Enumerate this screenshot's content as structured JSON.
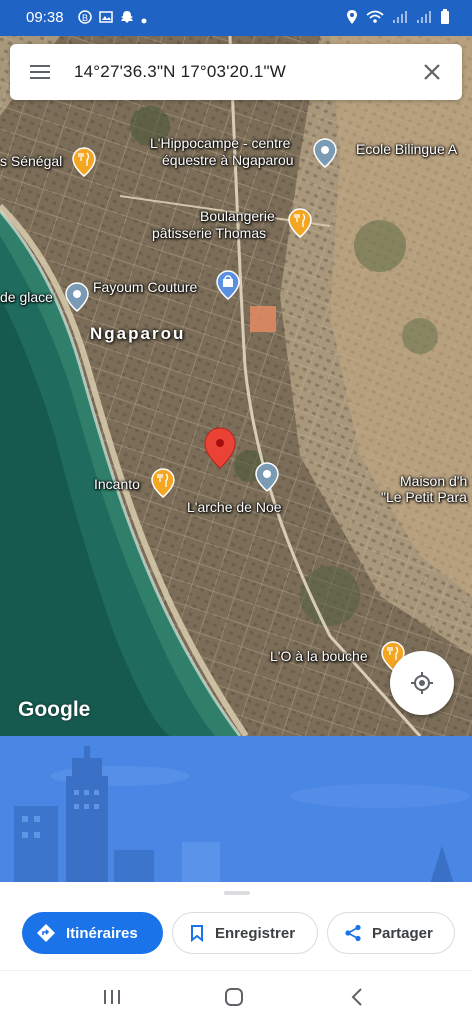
{
  "status_bar": {
    "time": "09:38"
  },
  "search": {
    "coordinates": "14°27'36.3\"N 17°03'20.1\"W"
  },
  "map": {
    "area_name": "Ngaparou",
    "places": [
      {
        "name": "s Sénégal",
        "type": "restaurant"
      },
      {
        "name": "L'Hippocampe - centre",
        "name2": "équestre à Ngaparou",
        "type": "place"
      },
      {
        "name": "Ecole Bilingue A",
        "type": "place"
      },
      {
        "name": "Boulangerie",
        "name2": "pâtisserie Thomas",
        "type": "restaurant"
      },
      {
        "name": "de glace",
        "type": "place"
      },
      {
        "name": "Fayoum Couture",
        "type": "shop"
      },
      {
        "name": "Incanto",
        "type": "restaurant"
      },
      {
        "name": "L'arche de Noe",
        "type": "place"
      },
      {
        "name": "Maison d'h",
        "name2": "\"Le Petit Para",
        "type": "place"
      },
      {
        "name": "L'O à la bouche",
        "type": "restaurant"
      }
    ],
    "logo": "Google"
  },
  "actions": {
    "directions": "Itinéraires",
    "save": "Enregistrer",
    "share": "Partager"
  },
  "colors": {
    "status_bar": "#1f63c4",
    "primary": "#1a73e8",
    "pin": "#ea4335",
    "food_poi": "#f4a623",
    "place_poi": "#7b9bb5"
  }
}
